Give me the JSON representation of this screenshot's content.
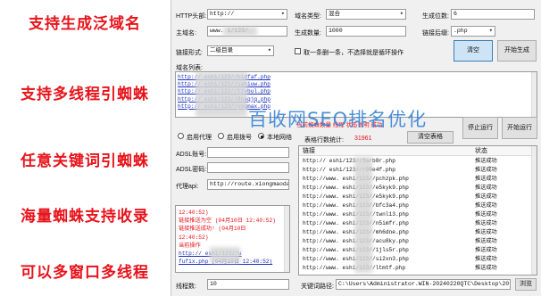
{
  "promo": {
    "line1": "支持生成泛域名",
    "line2": "支持多线程引蜘蛛",
    "line3": "任意关键词引蜘蛛",
    "line4": "海量蜘蛛支持收录",
    "line5": "可以多窗口多线程"
  },
  "form": {
    "http_label": "HTTP头部:",
    "http_value": "http://",
    "domain_type_label": "域名类型:",
    "domain_type_value": "混合",
    "gen_digits_label": "生成位数:",
    "gen_digits_value": "6",
    "main_domain_label": "主域名:",
    "main_domain_value": "www.      i/123/",
    "main_domain_hidden": "hi",
    "gen_count_label": "生成数量:",
    "gen_count_value": "1000",
    "link_suffix_label": "链接后缀:",
    "link_suffix_value": ".php",
    "link_form_label": "链接形式:",
    "link_form_value": "二级目录",
    "take_delete_label": "取一条删一条，不选择就是循环操作",
    "clear_button": "清空",
    "start_gen_button": "开始生成",
    "domain_list_label": "域名列表:"
  },
  "domain_list": [
    "http://      eshi/123//hidfaf.php",
    "http://      eshi/123//sahiuw.php",
    "http://      eshi/123//tzvbul.php",
    "http://      eshi/123//8naqjq.php",
    "http://      eshi/123//ymgmax.php"
  ],
  "watermark": "百收网SEO排名优化",
  "red_line": "当前蜘蛛数量 线程 状态说明 成功",
  "mode": {
    "proxy_label": "启用代理",
    "dial_label": "启用拨号",
    "local_label": "本地网络",
    "selected": "本地网络"
  },
  "counter": {
    "label": "表格行数统计:",
    "value": "31961",
    "clear_table_button": "清空表格"
  },
  "adsl": {
    "account_label": "ADSL账号:",
    "password_label": "ADSL密码:",
    "proxy_api_label": "代理api:",
    "proxy_api_value": "http://route.xiongmaodail"
  },
  "control": {
    "stop_button": "停止运行",
    "start_button": "开始运行"
  },
  "log": [
    {
      "text": "12:40:52)",
      "color": "#e8131b"
    },
    {
      "text": "链接推送为空 (04月10日 12:40:52)",
      "color": "#e8131b"
    },
    {
      "text": "链接推送成功! (04月10日",
      "color": "#e8131b"
    },
    {
      "text": "12:40:52)",
      "color": "#e8131b"
    },
    {
      "text": "当前操作",
      "color": "#e8131b"
    },
    {
      "text": "http://      eshi/123//u",
      "color": "#1a2fbf"
    },
    {
      "text": "fufix.php (04月10日 12:40:52)",
      "color": "#1a2fbf"
    }
  ],
  "table": {
    "col_link": "链接",
    "col_status": "状态",
    "rows": [
      {
        "link": "http://      eshi/123//3arb8r.php",
        "status": "推送成功"
      },
      {
        "link": "http://      eshi/123//r90e4f.php",
        "status": "推送成功"
      },
      {
        "link": "http://www.  eshi/123//pchzpk.php",
        "status": "推送成功"
      },
      {
        "link": "http://www.  eshi/123//e5kyk9.php",
        "status": "推送成功"
      },
      {
        "link": "http://www.  eshi/123//e5kyk9.php",
        "status": "推送成功"
      },
      {
        "link": "http://www.  eshi/123//bfc3a4.php",
        "status": "推送成功"
      },
      {
        "link": "http://www.  eshi/123//twnl13.php",
        "status": "推送成功"
      },
      {
        "link": "http://www.  eshi/123//n5imfr.php",
        "status": "推送成功"
      },
      {
        "link": "http://www.  eshi/123//mh6dne.php",
        "status": "推送成功"
      },
      {
        "link": "http://www.  eshi/123//acu8ky.php",
        "status": "推送成功"
      },
      {
        "link": "http://www.  eshi/123//1jls5r.php",
        "status": "推送成功"
      },
      {
        "link": "http://www.  eshi/123//si2xn3.php",
        "status": "推送成功"
      },
      {
        "link": "http://www.  eshi/123//ltmtf.php",
        "status": "推送成功"
      }
    ]
  },
  "bottom": {
    "threads_label": "线程数:",
    "threads_value": "10",
    "keyword_path_label": "关键词路径:",
    "keyword_path_value": "C:\\Users\\Administrator.WIN-20240220QTC\\Desktop\\20.tx",
    "browse_button": "浏览"
  }
}
